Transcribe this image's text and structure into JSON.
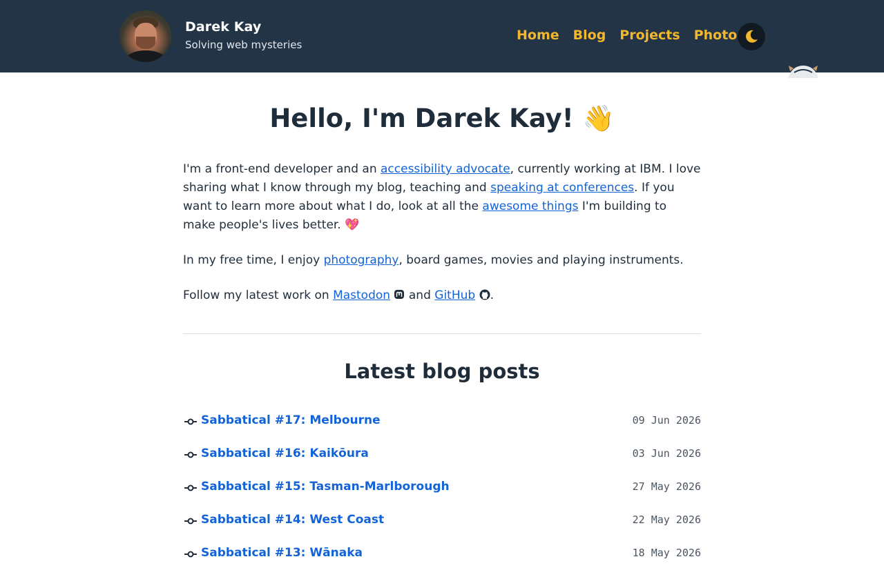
{
  "header": {
    "name": "Darek Kay",
    "tagline": "Solving web mysteries",
    "nav": [
      "Home",
      "Blog",
      "Projects",
      "Photos"
    ]
  },
  "hero": {
    "title": "Hello, I'm Darek Kay!",
    "emoji": "👋"
  },
  "intro": {
    "p1_a": "I'm a front-end developer and an ",
    "p1_link1": "accessibility advocate",
    "p1_b": ", currently working at IBM. I love sharing what I know through my blog, teaching and ",
    "p1_link2": "speaking at conferences",
    "p1_c": ". If you want to learn more about what I do, look at all the ",
    "p1_link3": "awesome things",
    "p1_d": " I'm building to make people's lives better. ",
    "p1_emoji": "💖",
    "p2_a": "In my free time, I enjoy ",
    "p2_link": "photography",
    "p2_b": ", board games, movies and playing instruments.",
    "p3_a": "Follow my latest work on ",
    "p3_link1": "Mastodon",
    "p3_b": " and ",
    "p3_link2": "GitHub",
    "p3_c": "."
  },
  "blog": {
    "heading": "Latest blog posts",
    "posts": [
      {
        "title": "Sabbatical #17: Melbourne",
        "date": "09 Jun 2026"
      },
      {
        "title": "Sabbatical #16: Kaikōura",
        "date": "03 Jun 2026"
      },
      {
        "title": "Sabbatical #15: Tasman-Marlborough",
        "date": "27 May 2026"
      },
      {
        "title": "Sabbatical #14: West Coast",
        "date": "22 May 2026"
      },
      {
        "title": "Sabbatical #13: Wānaka",
        "date": "18 May 2026"
      }
    ]
  },
  "icons": {
    "theme": "moon-icon",
    "mastodon": "mastodon-icon",
    "github": "github-icon",
    "post": "git-commit-icon"
  },
  "colors": {
    "header_bg": "#243447",
    "nav_link": "#f3b72e",
    "link": "#1363d6",
    "text": "#1f2d3a"
  }
}
